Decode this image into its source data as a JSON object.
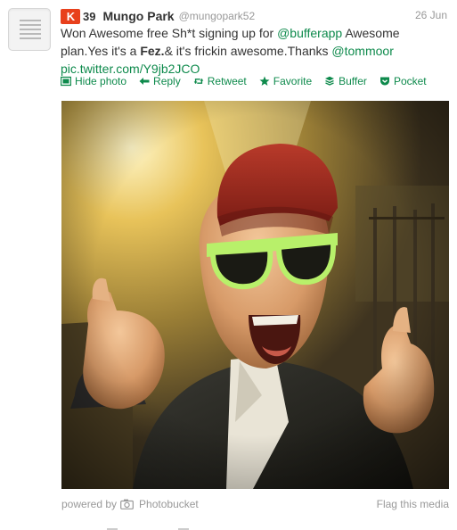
{
  "tweet": {
    "klout_icon": "K",
    "klout_score": "39",
    "fullname": "Mungo Park",
    "screenname": "@mungopark52",
    "date": "26 Jun",
    "text": {
      "part1": "Won Awesome free Sh*t signing up for ",
      "mention1": "@bufferapp",
      "part2": " Awesome plan.Yes it's a ",
      "bold": "Fez.",
      "part3": "& it's frickin awesome.Thanks ",
      "mention2": "@tommoor",
      "link": "pic.twitter.com/Y9jb2JCO"
    }
  },
  "actions": {
    "hide_photo": "Hide photo",
    "reply": "Reply",
    "retweet": "Retweet",
    "favorite": "Favorite",
    "buffer": "Buffer",
    "pocket": "Pocket"
  },
  "footer": {
    "powered_by": "powered by",
    "provider": "Photobucket",
    "flag": "Flag this media"
  },
  "colors": {
    "link": "#0e8a4c",
    "klout": "#e8401c",
    "muted": "#999999"
  },
  "icons": [
    "klout-icon",
    "photo-icon",
    "reply-icon",
    "retweet-icon",
    "star-icon",
    "buffer-icon",
    "pocket-icon",
    "camera-icon"
  ]
}
